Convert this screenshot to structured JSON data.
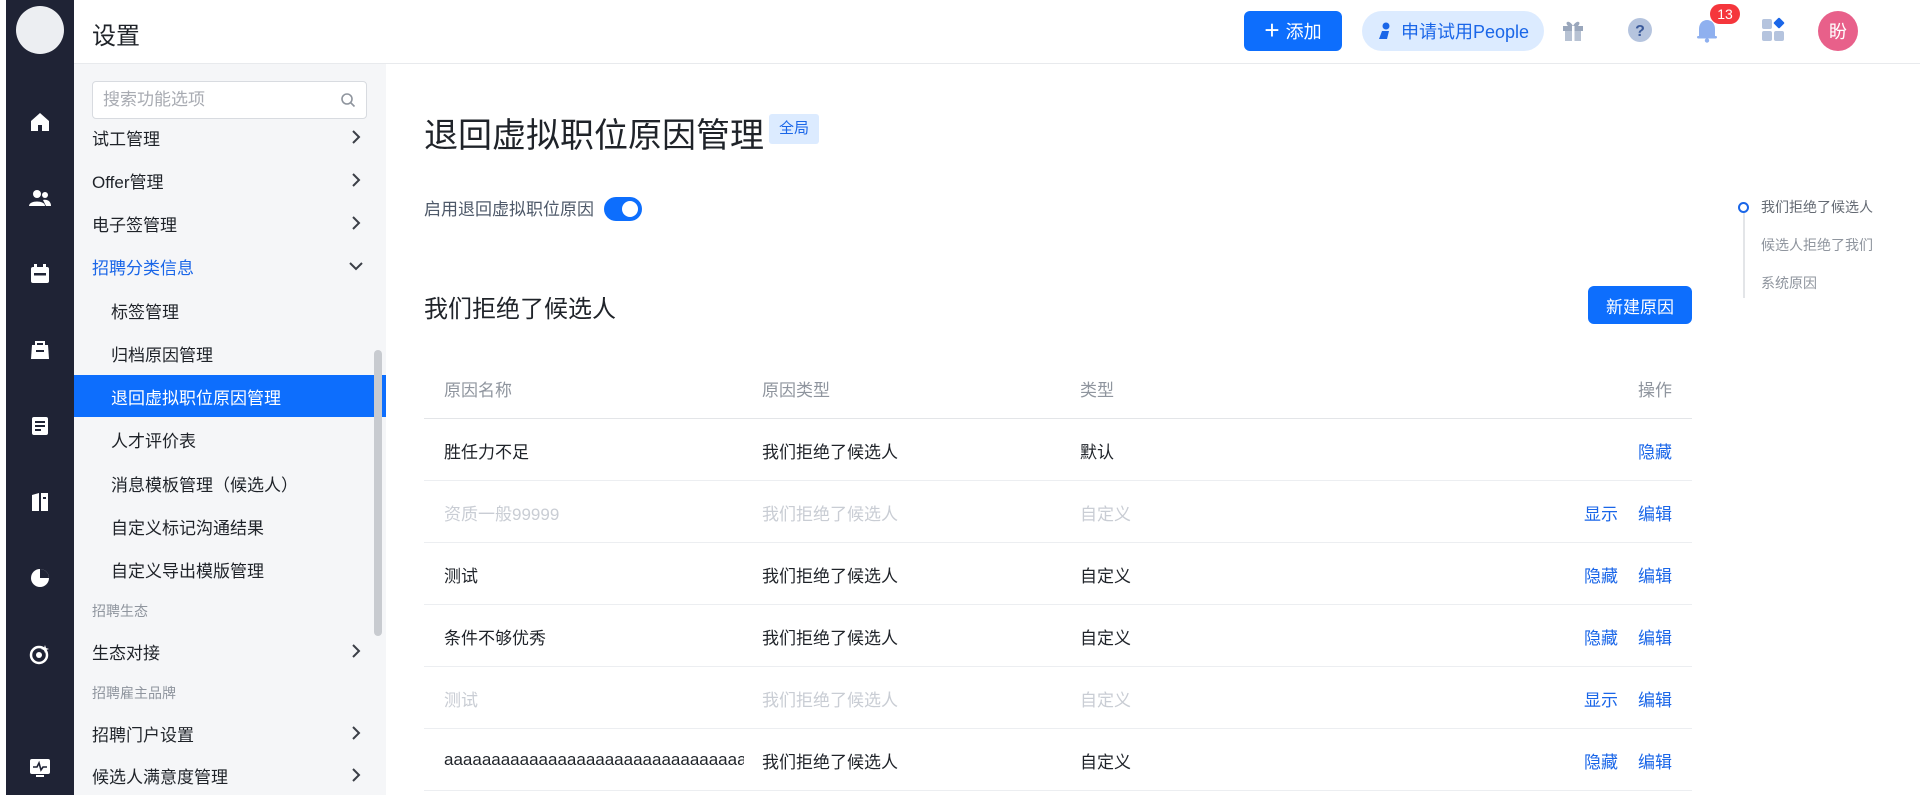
{
  "header": {
    "title": "设置",
    "add_label": "添加",
    "trial_label": "申请试用People",
    "notification_count": "13",
    "user_initial": "盼"
  },
  "sidebar": {
    "search_placeholder": "搜索功能选项",
    "items": [
      {
        "label": "试工管理"
      },
      {
        "label": "Offer管理"
      },
      {
        "label": "电子签管理"
      },
      {
        "label": "招聘分类信息"
      },
      {
        "label": "标签管理"
      },
      {
        "label": "归档原因管理"
      },
      {
        "label": "退回虚拟职位原因管理"
      },
      {
        "label": "人才评价表"
      },
      {
        "label": "消息模板管理（候选人）"
      },
      {
        "label": "自定义标记沟通结果"
      },
      {
        "label": "自定义导出模版管理"
      },
      {
        "label": "生态对接"
      },
      {
        "label": "招聘门户设置"
      },
      {
        "label": "候选人满意度管理"
      }
    ],
    "groups": [
      "招聘生态",
      "招聘雇主品牌"
    ]
  },
  "main": {
    "title": "退回虚拟职位原因管理",
    "scope_tag": "全局",
    "toggle_label": "启用退回虚拟职位原因",
    "toggle_on": true,
    "section_title": "我们拒绝了候选人",
    "new_button": "新建原因",
    "table": {
      "headers": [
        "原因名称",
        "原因类型",
        "类型",
        "操作"
      ],
      "rows": [
        {
          "name": "胜任力不足",
          "reason_type": "我们拒绝了候选人",
          "type": "默认",
          "ops": [
            "隐藏"
          ],
          "disabled": false
        },
        {
          "name": "资质一般99999",
          "reason_type": "我们拒绝了候选人",
          "type": "自定义",
          "ops": [
            "显示",
            "编辑"
          ],
          "disabled": true
        },
        {
          "name": "测试",
          "reason_type": "我们拒绝了候选人",
          "type": "自定义",
          "ops": [
            "隐藏",
            "编辑"
          ],
          "disabled": false
        },
        {
          "name": "条件不够优秀",
          "reason_type": "我们拒绝了候选人",
          "type": "自定义",
          "ops": [
            "隐藏",
            "编辑"
          ],
          "disabled": false
        },
        {
          "name": "测试",
          "reason_type": "我们拒绝了候选人",
          "type": "自定义",
          "ops": [
            "显示",
            "编辑"
          ],
          "disabled": true
        },
        {
          "name": "aaaaaaaaaaaaaaaaaaaaaaaaaaaaaaaa...",
          "reason_type": "我们拒绝了候选人",
          "type": "自定义",
          "ops": [
            "隐藏",
            "编辑"
          ],
          "disabled": false
        }
      ]
    }
  },
  "anchor_nav": {
    "items": [
      "我们拒绝了候选人",
      "候选人拒绝了我们",
      "系统原因"
    ]
  },
  "icons": {
    "rail": [
      "home-icon",
      "people-icon",
      "calendar-icon",
      "briefcase-icon",
      "document-icon",
      "book-icon",
      "pie-chart-icon",
      "target-icon",
      "monitor-icon"
    ],
    "header": [
      "gift-icon",
      "help-icon",
      "bell-icon",
      "apps-icon"
    ]
  },
  "colors": {
    "primary": "#0d6efd",
    "rail_bg": "#1f2335",
    "menu_bg": "#f5f6f8",
    "badge": "#f5363c",
    "avatar": "#e8608a"
  }
}
